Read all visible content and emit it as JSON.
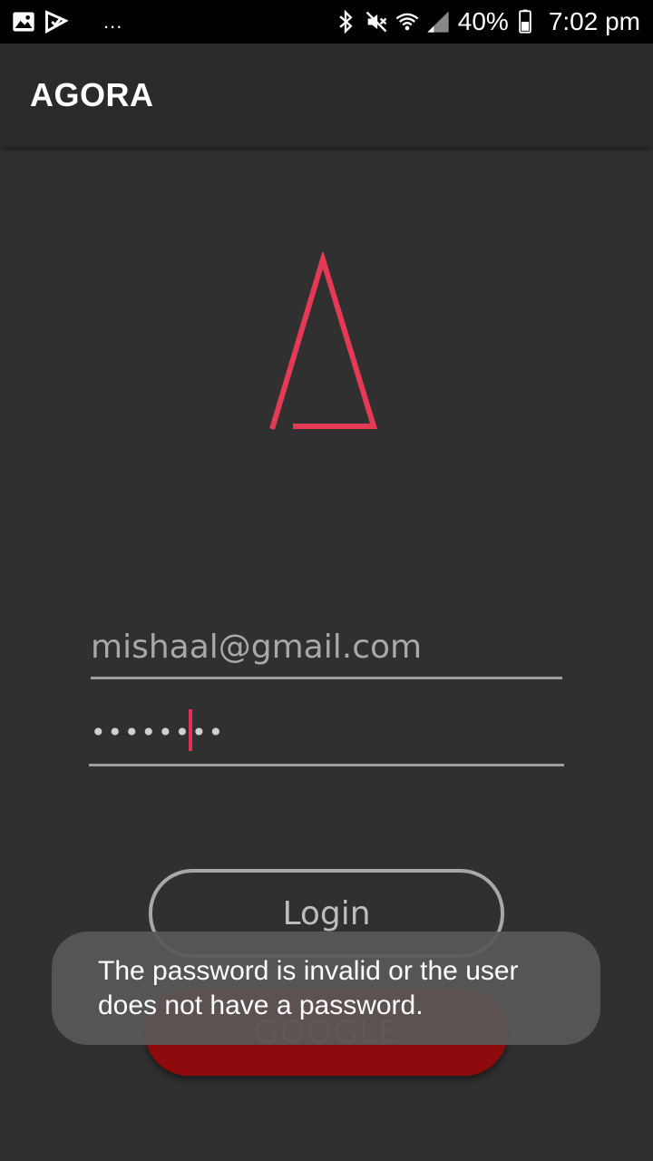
{
  "status_bar": {
    "left_icons": [
      "image-icon",
      "download-icon"
    ],
    "dots": "...",
    "right_icons": [
      "bluetooth-icon",
      "mute-icon",
      "wifi-icon",
      "signal-icon",
      "battery-icon"
    ],
    "battery": "40%",
    "time": "7:02 pm"
  },
  "app_bar": {
    "title": "AGORA"
  },
  "logo": {
    "color": "#e53955",
    "icon": "agora-triangle-logo"
  },
  "form": {
    "email": {
      "value": "mishaal@gmail.com"
    },
    "password": {
      "masked": "••••••••"
    },
    "login_label": "Login",
    "google_label": "GOOGLE"
  },
  "toast": {
    "message": "The password is invalid or the user does not have a password."
  },
  "colors": {
    "background": "#303030",
    "accent": "#e0305a",
    "google_button": "#8e0b0d"
  }
}
